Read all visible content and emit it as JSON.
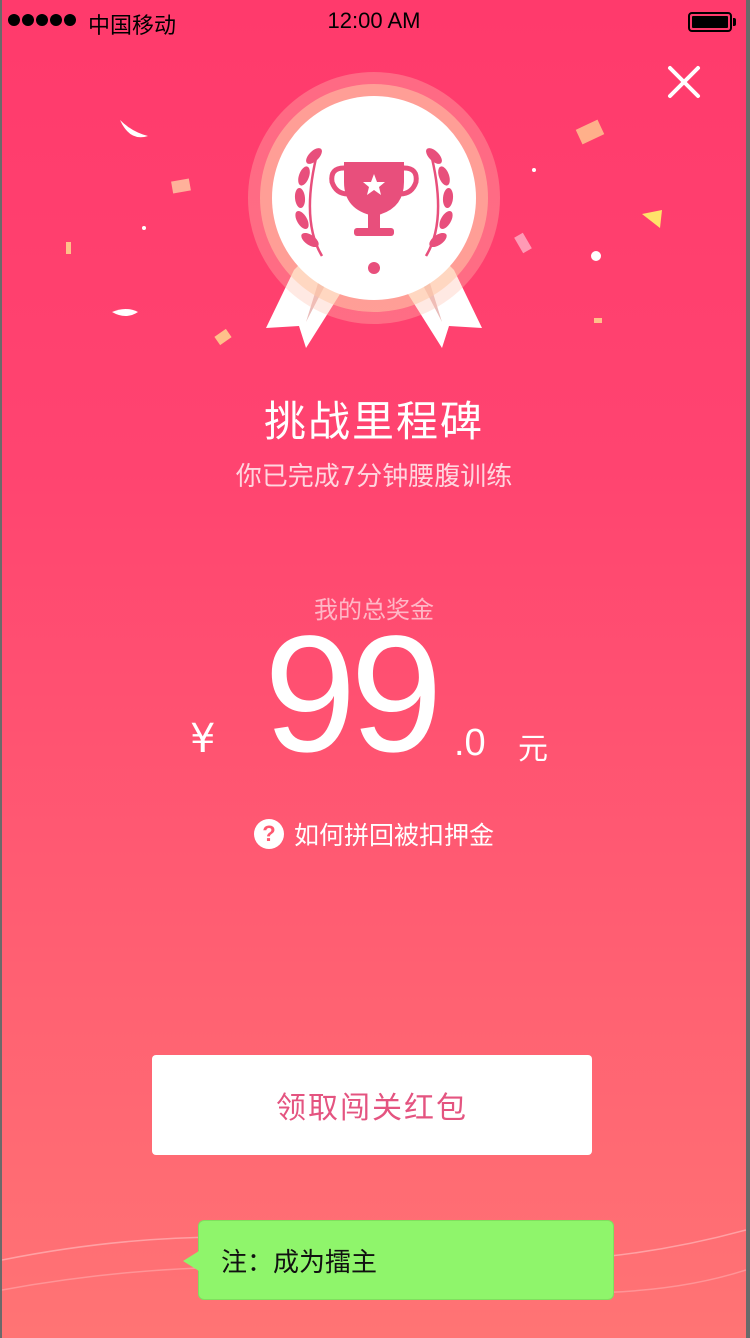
{
  "status_bar": {
    "carrier": "中国移动",
    "time": "12:00 AM"
  },
  "close_icon": "close-icon",
  "milestone": {
    "title": "挑战里程碑",
    "subtitle": "你已完成7分钟腰腹训练"
  },
  "prize": {
    "label": "我的总奖金",
    "currency": "¥",
    "amount_integer": "99",
    "amount_decimal": ".0",
    "unit": "元"
  },
  "help": {
    "icon": "question-icon",
    "label": "如何拼回被扣押金"
  },
  "claim_button": {
    "label": "领取闯关红包"
  },
  "note": {
    "text": "注：成为擂主"
  },
  "colors": {
    "background_top": "#ff3a6c",
    "background_bottom": "#ff7474",
    "button_text": "#e45480",
    "note_bg": "#8ff56b"
  }
}
